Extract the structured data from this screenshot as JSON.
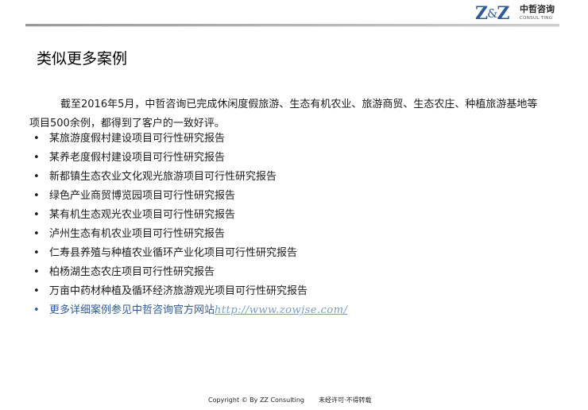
{
  "logo": {
    "mark_left": "Z",
    "mark_amp": "&",
    "mark_right": "Z",
    "cn_name": "中哲咨询",
    "en_name": "CONSUL TING"
  },
  "title": "类似更多案例",
  "intro": "截至2016年5月，中哲咨询已完成休闲度假旅游、生态有机农业、旅游商贸、生态农庄、种植旅游基地等项目500余例，都得到了客户的一致好评。",
  "bullet_char": "•",
  "cases": [
    "某旅游度假村建设项目可行性研究报告",
    "某养老度假村建设项目可行性研究报告",
    "新都镇生态农业文化观光旅游项目可行性研究报告",
    "绿色产业商贸博览园项目可行性研究报告",
    "某有机生态观光农业项目可行性研究报告",
    "泸州生态有机农业项目可行性研究报告",
    "仁寿县养殖与种植农业循环产业化项目可行性研究报告",
    "柏杨湖生态农庄项目可行性研究报告",
    "万亩中药材种植及循环经济旅游观光项目可行性研究报告"
  ],
  "more": {
    "text": "更多详细案例参见中哲咨询官方网站",
    "link": "http://www.zowjse.com/"
  },
  "footer": {
    "copyright": "Copyright © By  ZZ Consulting",
    "note": "未经许可·不得转载"
  },
  "colors": {
    "brand_blue": "#2f5a9a",
    "link_blue": "#7a9cc8"
  }
}
